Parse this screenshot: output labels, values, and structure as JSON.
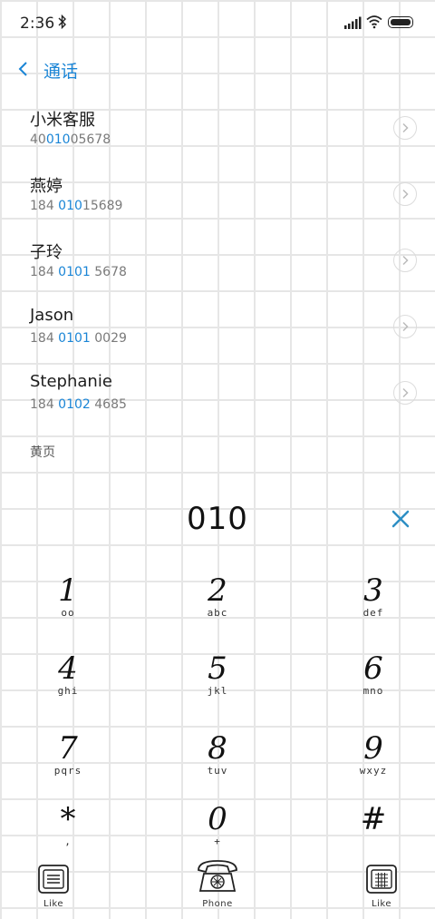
{
  "status": {
    "time": "2:36"
  },
  "header": {
    "title": "通话"
  },
  "contacts": [
    {
      "name": "小米客服",
      "num_pre": "40",
      "num_hl": "010",
      "num_post": "05678"
    },
    {
      "name": "燕婷",
      "num_pre": "184 ",
      "num_hl": "010",
      "num_post": "15689"
    },
    {
      "name": "子玲",
      "num_pre": "184 ",
      "num_hl": "0101",
      "num_post": " 5678"
    },
    {
      "name": "Jason",
      "num_pre": "184 ",
      "num_hl": "0101",
      "num_post": " 0029"
    },
    {
      "name": "Stephanie",
      "num_pre": "184 ",
      "num_hl": "0102",
      "num_post": " 4685"
    }
  ],
  "section_label": "黄页",
  "dialer": {
    "number": "010",
    "keys": [
      {
        "digit": "1",
        "letters": "oo"
      },
      {
        "digit": "2",
        "letters": "abc"
      },
      {
        "digit": "3",
        "letters": "def"
      },
      {
        "digit": "4",
        "letters": "ghi"
      },
      {
        "digit": "5",
        "letters": "jkl"
      },
      {
        "digit": "6",
        "letters": "mno"
      },
      {
        "digit": "7",
        "letters": "pqrs"
      },
      {
        "digit": "8",
        "letters": "tuv"
      },
      {
        "digit": "9",
        "letters": "wxyz"
      },
      {
        "digit": "*",
        "letters": ","
      },
      {
        "digit": "0",
        "letters": "+"
      },
      {
        "digit": "#",
        "letters": ""
      }
    ]
  },
  "bottom": {
    "left_label": "Like",
    "center_label": "Phone",
    "right_label": "Like"
  },
  "colors": {
    "accent": "#1a85d6",
    "grid": "#e6e6e6"
  }
}
